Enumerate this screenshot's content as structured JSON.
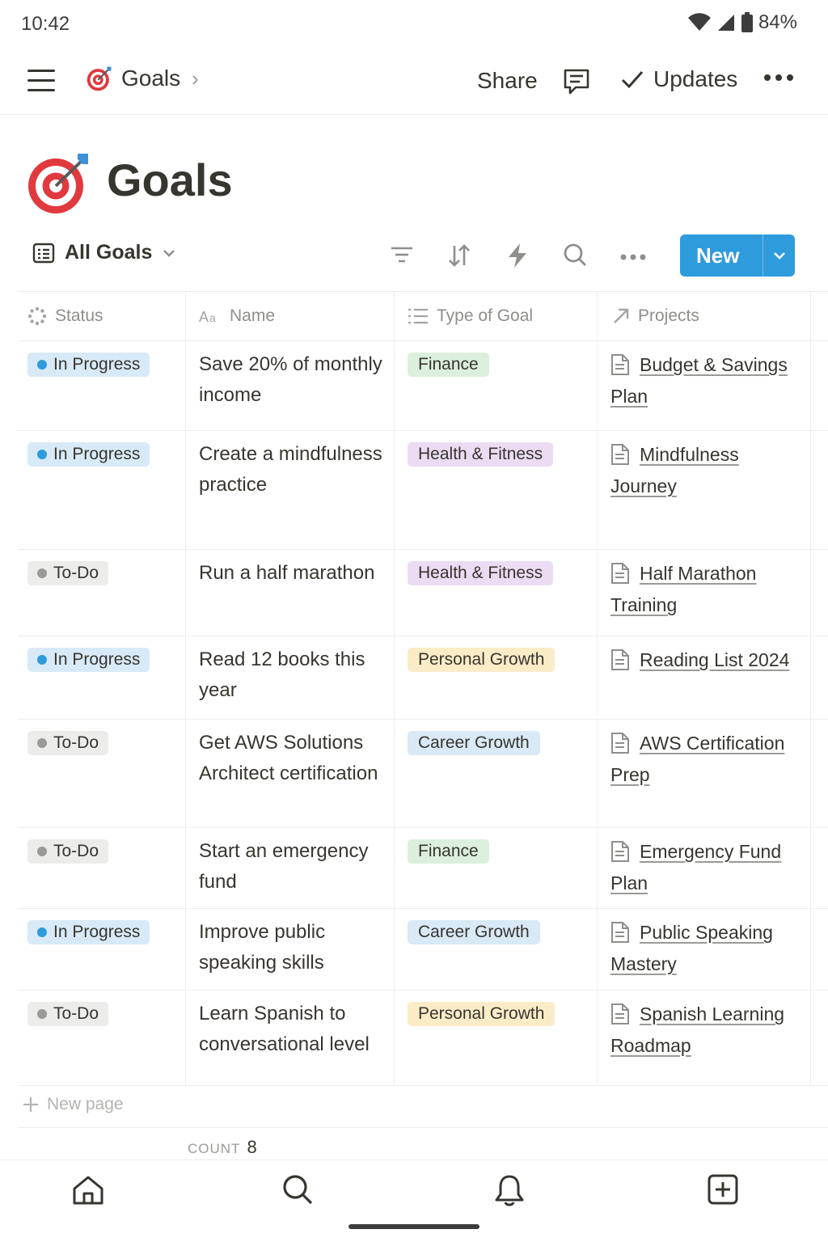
{
  "status_bar": {
    "time": "10:42",
    "battery": "84%"
  },
  "nav": {
    "breadcrumb_title": "Goals",
    "share_label": "Share",
    "updates_label": "Updates"
  },
  "page": {
    "title": "Goals"
  },
  "view": {
    "name": "All Goals",
    "new_label": "New"
  },
  "colors": {
    "accent": "#2e9bdc",
    "in_progress_dot": "#2e9bdc",
    "todo_dot": "#9b9a97"
  },
  "table": {
    "headers": {
      "status": "Status",
      "name": "Name",
      "type": "Type of Goal",
      "projects": "Projects"
    },
    "rows": [
      {
        "status": "In Progress",
        "name": "Save 20% of monthly income",
        "type": "Finance",
        "project": "Budget & Savings Plan"
      },
      {
        "status": "In Progress",
        "name": "Create a mindfulness practice",
        "type": "Health & Fitness",
        "project": "Mindfulness Journey"
      },
      {
        "status": "To-Do",
        "name": "Run a half marathon",
        "type": "Health & Fitness",
        "project": "Half Marathon Training"
      },
      {
        "status": "In Progress",
        "name": "Read 12 books this year",
        "type": "Personal Growth",
        "project": "Reading List 2024"
      },
      {
        "status": "To-Do",
        "name": "Get AWS Solutions Architect certification",
        "type": "Career Growth",
        "project": "AWS Certification Prep"
      },
      {
        "status": "To-Do",
        "name": "Start an emergency fund",
        "type": "Finance",
        "project": "Emergency Fund Plan"
      },
      {
        "status": "In Progress",
        "name": "Improve public speaking skills",
        "type": "Career Growth",
        "project": "Public Speaking Mastery"
      },
      {
        "status": "To-Do",
        "name": "Learn Spanish to conversational level",
        "type": "Personal Growth",
        "project": "Spanish Learning Roadmap"
      }
    ]
  },
  "footer": {
    "new_page_label": "New page",
    "count_label": "COUNT",
    "count_value": "8"
  }
}
